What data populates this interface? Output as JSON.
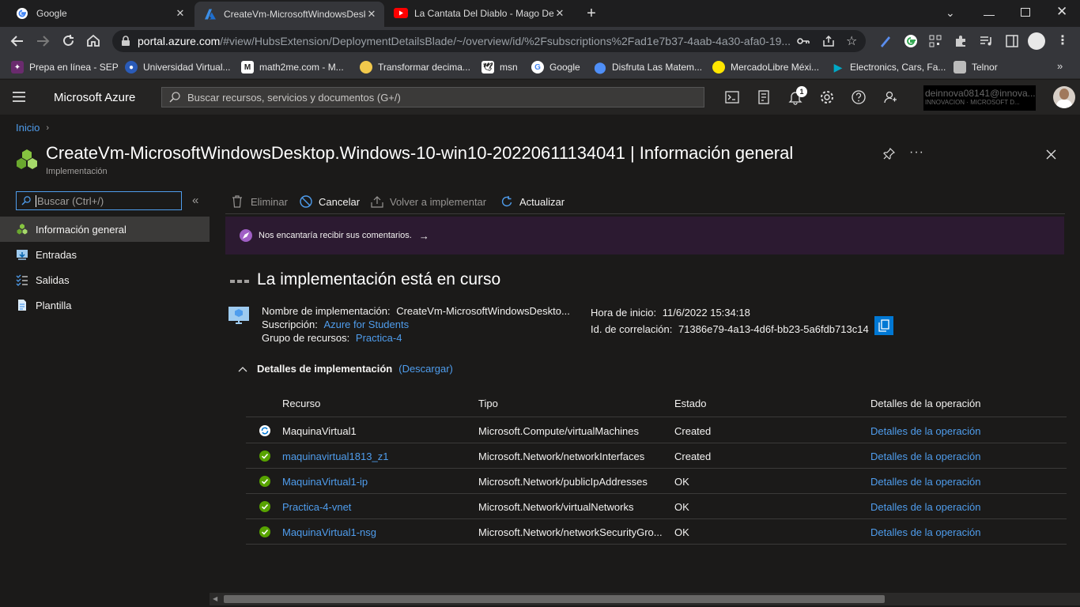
{
  "browser": {
    "tabs": [
      {
        "title": "Google",
        "icon": "google-icon"
      },
      {
        "title": "CreateVm-MicrosoftWindowsDesk",
        "icon": "azure-icon"
      },
      {
        "title": "La Cantata Del Diablo - Mago De",
        "icon": "youtube-icon"
      }
    ],
    "url_host": "portal.azure.com",
    "url_path": "/#view/HubsExtension/DeploymentDetailsBlade/~/overview/id/%2Fsubscriptions%2Fad1e7b37-4aab-4a30-afa0-19...",
    "bookmarks": [
      {
        "label": "Prepa en línea - SEP",
        "icon": "sep-icon"
      },
      {
        "label": "Universidad Virtual...",
        "icon": "university-icon"
      },
      {
        "label": "math2me.com - M...",
        "icon": "math2me-icon"
      },
      {
        "label": "Transformar decima...",
        "icon": "lemon-icon"
      },
      {
        "label": "msn",
        "icon": "msn-icon"
      },
      {
        "label": "Google",
        "icon": "google-icon"
      },
      {
        "label": "Disfruta Las Matem...",
        "icon": "location-icon"
      },
      {
        "label": "MercadoLibre Méxi...",
        "icon": "mercadolibre-icon"
      },
      {
        "label": "Electronics, Cars, Fa...",
        "icon": "ebay-icon"
      },
      {
        "label": "Telnor",
        "icon": "telnor-icon"
      }
    ]
  },
  "azure": {
    "brand": "Microsoft Azure",
    "search_placeholder": "Buscar recursos, servicios y documentos (G+/)",
    "notification_count": "1",
    "user_email": "deinnova08141@innova...",
    "user_org": "INNOVACION · MICROSOFT D..."
  },
  "page": {
    "breadcrumb": "Inicio",
    "title": "CreateVm-MicrosoftWindowsDesktop.Windows-10-win10-20220611134041 | Información general",
    "subtitle": "Implementación",
    "nav_search_placeholder": "Buscar (Ctrl+/)",
    "nav": [
      {
        "label": "Información general",
        "icon": "overview-icon"
      },
      {
        "label": "Entradas",
        "icon": "inputs-icon"
      },
      {
        "label": "Salidas",
        "icon": "outputs-icon"
      },
      {
        "label": "Plantilla",
        "icon": "template-icon"
      }
    ],
    "commands": {
      "delete": "Eliminar",
      "cancel": "Cancelar",
      "redeploy": "Volver a implementar",
      "refresh": "Actualizar"
    },
    "feedback": "Nos encantaría recibir sus comentarios.",
    "status_heading": "La implementación está en curso",
    "info": {
      "name_label": "Nombre de implementación:",
      "name_value": "CreateVm-MicrosoftWindowsDeskto...",
      "subscription_label": "Suscripción:",
      "subscription_value": "Azure for Students",
      "rg_label": "Grupo de recursos:",
      "rg_value": "Practica-4",
      "start_label": "Hora de inicio:",
      "start_value": "11/6/2022 15:34:18",
      "corr_label": "Id. de correlación:",
      "corr_value": "71386e79-4a13-4d6f-bb23-5a6fdb713c14"
    },
    "details_heading": "Detalles de implementación",
    "download_link": "(Descargar)",
    "table": {
      "headers": [
        "Recurso",
        "Tipo",
        "Estado",
        "Detalles de la operación"
      ],
      "rows": [
        {
          "resource": "MaquinaVirtual1",
          "type": "Microsoft.Compute/virtualMachines",
          "status": "Created",
          "details": "Detalles de la operación",
          "icon": "in-progress-icon",
          "linked": false
        },
        {
          "resource": "maquinavirtual1813_z1",
          "type": "Microsoft.Network/networkInterfaces",
          "status": "Created",
          "details": "Detalles de la operación",
          "icon": "success-icon",
          "linked": true
        },
        {
          "resource": "MaquinaVirtual1-ip",
          "type": "Microsoft.Network/publicIpAddresses",
          "status": "OK",
          "details": "Detalles de la operación",
          "icon": "success-icon",
          "linked": true
        },
        {
          "resource": "Practica-4-vnet",
          "type": "Microsoft.Network/virtualNetworks",
          "status": "OK",
          "details": "Detalles de la operación",
          "icon": "success-icon",
          "linked": true
        },
        {
          "resource": "MaquinaVirtual1-nsg",
          "type": "Microsoft.Network/networkSecurityGro...",
          "status": "OK",
          "details": "Detalles de la operación",
          "icon": "success-icon",
          "linked": true
        }
      ]
    }
  },
  "colors": {
    "accent": "#4f9ded",
    "success": "#57a300",
    "feedback_bg": "#2c1a31"
  }
}
